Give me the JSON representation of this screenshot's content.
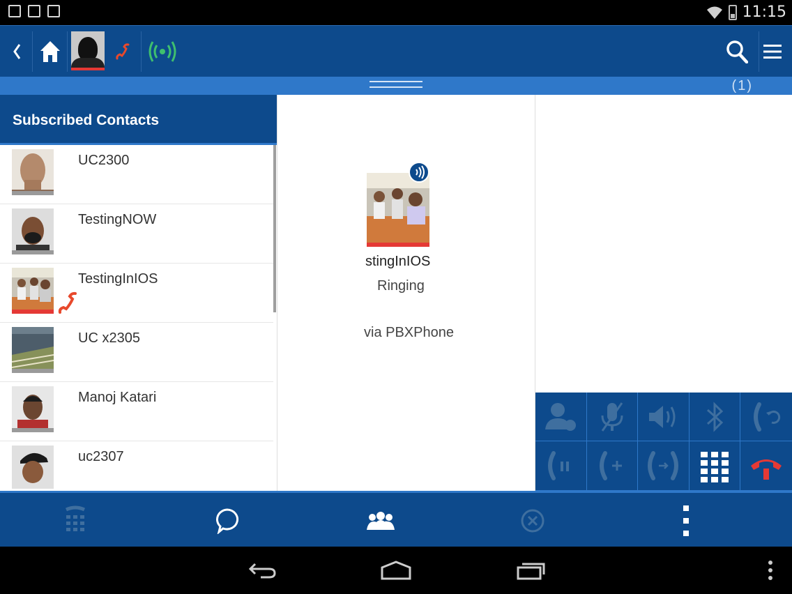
{
  "statusbar": {
    "time": "11:15",
    "icons": [
      "gallery-icon",
      "play-store-icon",
      "clipboard-check-icon"
    ],
    "system": [
      "wifi-icon",
      "battery-icon"
    ]
  },
  "topbar": {
    "buttons": [
      "back-icon",
      "home-icon",
      "active-call-avatar",
      "phone-ringing-icon",
      "signal-broadcast-icon",
      "search-icon",
      "menu-icon"
    ]
  },
  "handlebar": {
    "count": "(1)"
  },
  "contacts": {
    "title": "Subscribed Contacts",
    "items": [
      {
        "name": "UC2300",
        "ringing": false
      },
      {
        "name": "TestingNOW",
        "ringing": false
      },
      {
        "name": "TestingInIOS",
        "ringing": true
      },
      {
        "name": "UC x2305",
        "ringing": false
      },
      {
        "name": "Manoj Katari",
        "ringing": false
      },
      {
        "name": "uc2307",
        "ringing": false
      }
    ]
  },
  "call": {
    "name": "stingInIOS",
    "status": "Ringing",
    "via": "via PBXPhone"
  },
  "controls": {
    "buttons": [
      "contact-icon",
      "mute-icon",
      "speaker-icon",
      "bluetooth-icon",
      "transfer-icon",
      "hold-icon",
      "add-call-icon",
      "merge-call-icon",
      "keypad-icon",
      "hangup-icon"
    ]
  },
  "tabbar": {
    "tabs": [
      "dialpad-icon",
      "chat-icon",
      "contacts-group-icon",
      "cancel-icon",
      "more-icon"
    ]
  },
  "navbar": {
    "buttons": [
      "back-nav-icon",
      "home-nav-icon",
      "recents-nav-icon",
      "overflow-icon"
    ]
  },
  "colors": {
    "primary": "#0d4a8c",
    "accent": "#2f78c9",
    "ringing": "#e53935",
    "signal": "#3fbf6e"
  }
}
